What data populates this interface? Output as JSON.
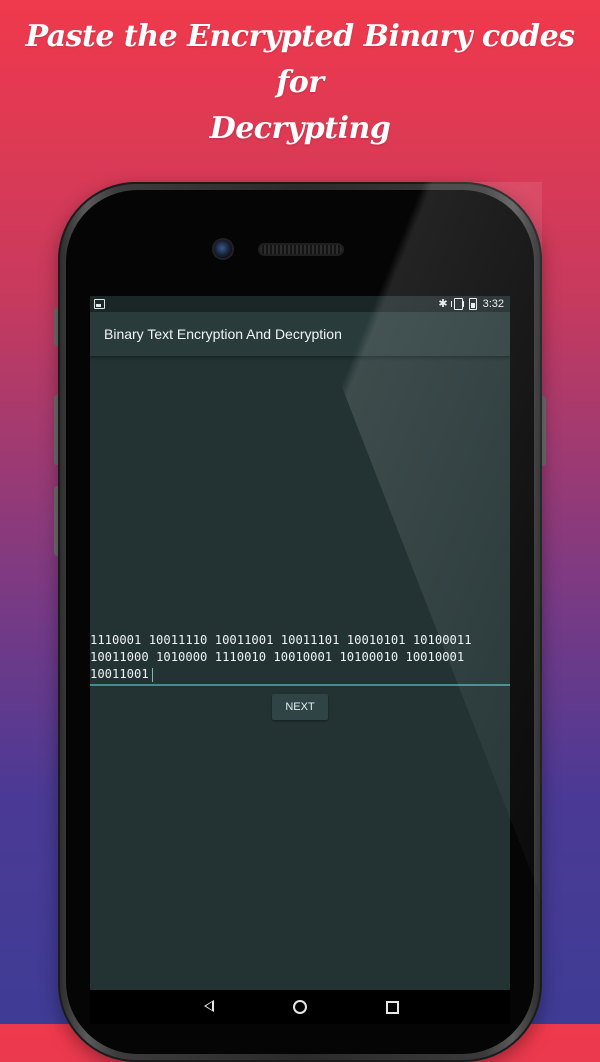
{
  "promo": {
    "line1": "Paste the Encrypted Binary codes for",
    "line2": "Decrypting"
  },
  "status_bar": {
    "time": "3:32",
    "icons": [
      "image-notification-icon",
      "bluetooth-icon",
      "vibrate-icon",
      "battery-icon"
    ]
  },
  "app_bar": {
    "title": "Binary Text Encryption And Decryption"
  },
  "binary_input": {
    "value": "1110001 10011110 10011001 10011101 10010101 10100011 10011000 1010000 1110010 10010001 10100010 10010001 10011001"
  },
  "next_button": {
    "label": "NEXT"
  },
  "nav_bar": {
    "icons": [
      "back-icon",
      "home-icon",
      "recents-icon"
    ]
  },
  "colors": {
    "gradient_top": "#f0394c",
    "gradient_bottom": "#3f3c95",
    "screen_bg": "#233333",
    "app_bar_bg": "#2a3b3b",
    "input_underline": "#3f8f8f",
    "button_bg": "#2f4545"
  }
}
